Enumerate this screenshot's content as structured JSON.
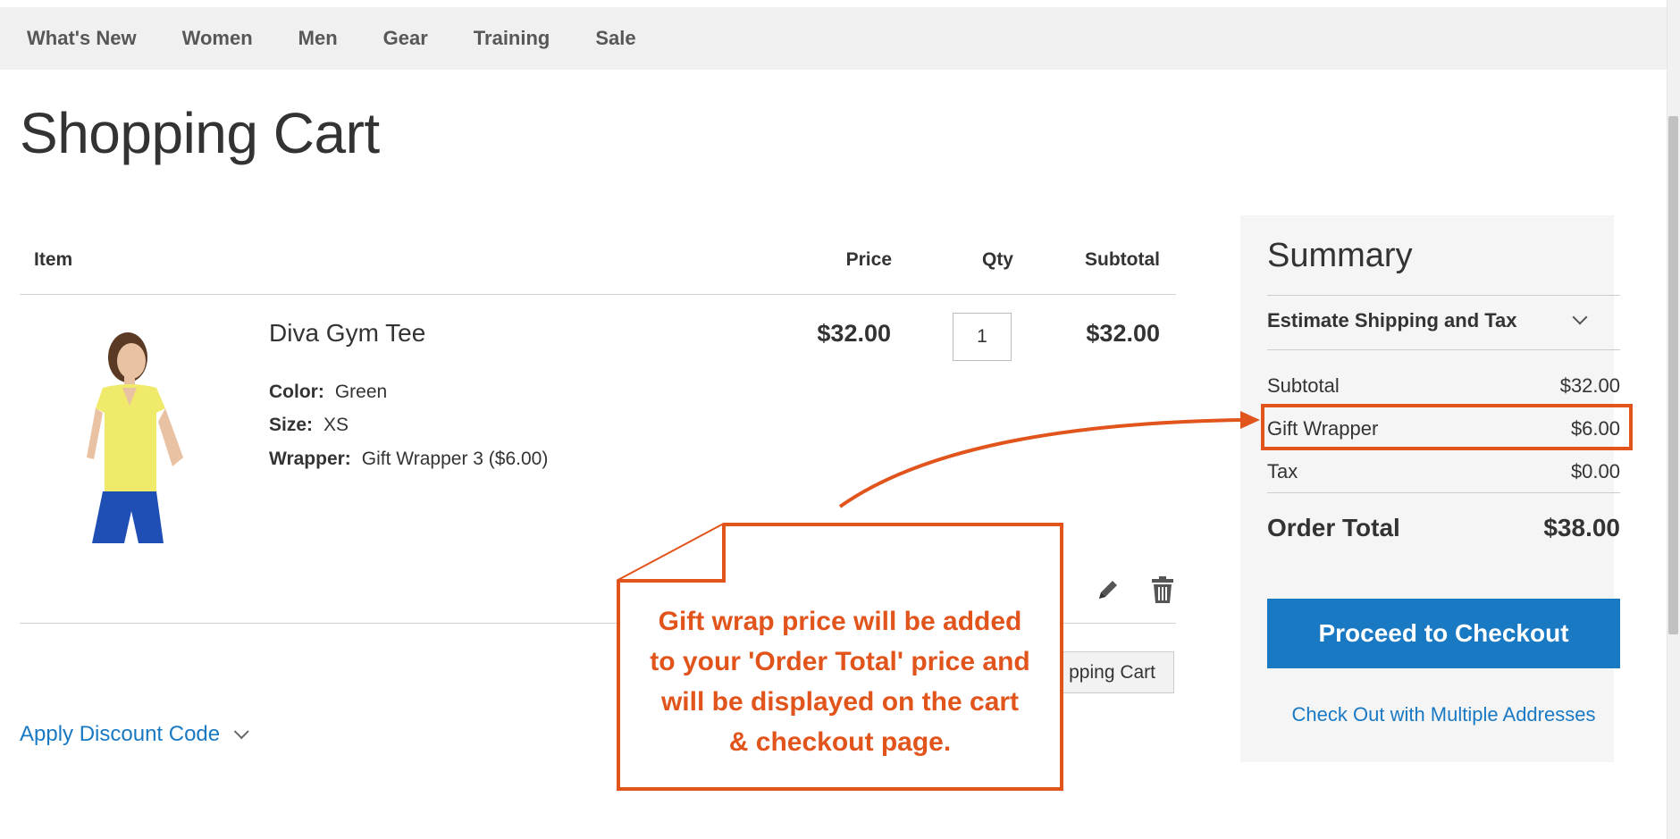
{
  "nav": {
    "items": [
      "What's New",
      "Women",
      "Men",
      "Gear",
      "Training",
      "Sale"
    ]
  },
  "page": {
    "title": "Shopping Cart"
  },
  "cart": {
    "columns": {
      "item": "Item",
      "price": "Price",
      "qty": "Qty",
      "subtotal": "Subtotal"
    },
    "item": {
      "name": "Diva Gym Tee",
      "options": [
        {
          "label": "Color:",
          "value": "Green"
        },
        {
          "label": "Size:",
          "value": "XS"
        },
        {
          "label": "Wrapper:",
          "value": "Gift Wrapper 3 ($6.00)"
        }
      ],
      "price": "$32.00",
      "qty": "1",
      "subtotal": "$32.00"
    },
    "update_button": "pping Cart",
    "discount_label": "Apply Discount Code"
  },
  "summary": {
    "title": "Summary",
    "estimate_label": "Estimate Shipping and Tax",
    "rows": [
      {
        "label": "Subtotal",
        "value": "$32.00"
      },
      {
        "label": "Gift Wrapper",
        "value": "$6.00"
      },
      {
        "label": "Tax",
        "value": "$0.00"
      }
    ],
    "total_label": "Order Total",
    "total_value": "$38.00",
    "checkout_button": "Proceed to Checkout",
    "multi_address_link": "Check Out with Multiple Addresses"
  },
  "annotation": {
    "lines": [
      "Gift wrap price will be added",
      "to your 'Order Total' price and",
      "will be displayed on the cart",
      "& checkout page."
    ],
    "color": "#e1541c"
  },
  "colors": {
    "accent": "#1979c3",
    "annotation": "#e1541c"
  }
}
